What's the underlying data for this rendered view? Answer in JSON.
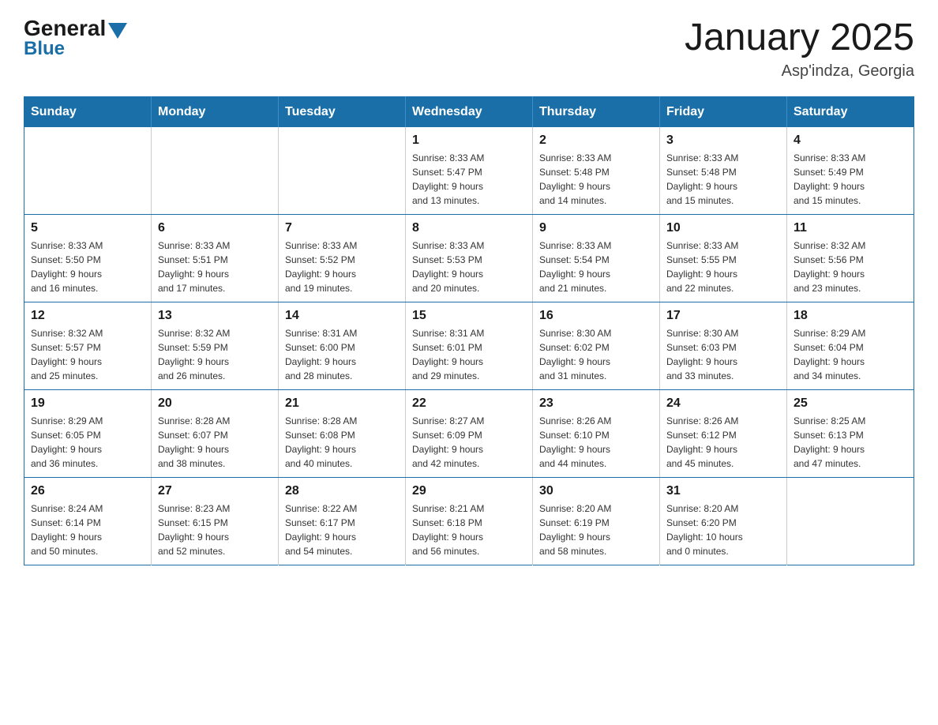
{
  "header": {
    "logo_general": "General",
    "logo_blue": "Blue",
    "title": "January 2025",
    "subtitle": "Asp'indza, Georgia"
  },
  "days_of_week": [
    "Sunday",
    "Monday",
    "Tuesday",
    "Wednesday",
    "Thursday",
    "Friday",
    "Saturday"
  ],
  "weeks": [
    [
      {
        "day": "",
        "info": ""
      },
      {
        "day": "",
        "info": ""
      },
      {
        "day": "",
        "info": ""
      },
      {
        "day": "1",
        "info": "Sunrise: 8:33 AM\nSunset: 5:47 PM\nDaylight: 9 hours\nand 13 minutes."
      },
      {
        "day": "2",
        "info": "Sunrise: 8:33 AM\nSunset: 5:48 PM\nDaylight: 9 hours\nand 14 minutes."
      },
      {
        "day": "3",
        "info": "Sunrise: 8:33 AM\nSunset: 5:48 PM\nDaylight: 9 hours\nand 15 minutes."
      },
      {
        "day": "4",
        "info": "Sunrise: 8:33 AM\nSunset: 5:49 PM\nDaylight: 9 hours\nand 15 minutes."
      }
    ],
    [
      {
        "day": "5",
        "info": "Sunrise: 8:33 AM\nSunset: 5:50 PM\nDaylight: 9 hours\nand 16 minutes."
      },
      {
        "day": "6",
        "info": "Sunrise: 8:33 AM\nSunset: 5:51 PM\nDaylight: 9 hours\nand 17 minutes."
      },
      {
        "day": "7",
        "info": "Sunrise: 8:33 AM\nSunset: 5:52 PM\nDaylight: 9 hours\nand 19 minutes."
      },
      {
        "day": "8",
        "info": "Sunrise: 8:33 AM\nSunset: 5:53 PM\nDaylight: 9 hours\nand 20 minutes."
      },
      {
        "day": "9",
        "info": "Sunrise: 8:33 AM\nSunset: 5:54 PM\nDaylight: 9 hours\nand 21 minutes."
      },
      {
        "day": "10",
        "info": "Sunrise: 8:33 AM\nSunset: 5:55 PM\nDaylight: 9 hours\nand 22 minutes."
      },
      {
        "day": "11",
        "info": "Sunrise: 8:32 AM\nSunset: 5:56 PM\nDaylight: 9 hours\nand 23 minutes."
      }
    ],
    [
      {
        "day": "12",
        "info": "Sunrise: 8:32 AM\nSunset: 5:57 PM\nDaylight: 9 hours\nand 25 minutes."
      },
      {
        "day": "13",
        "info": "Sunrise: 8:32 AM\nSunset: 5:59 PM\nDaylight: 9 hours\nand 26 minutes."
      },
      {
        "day": "14",
        "info": "Sunrise: 8:31 AM\nSunset: 6:00 PM\nDaylight: 9 hours\nand 28 minutes."
      },
      {
        "day": "15",
        "info": "Sunrise: 8:31 AM\nSunset: 6:01 PM\nDaylight: 9 hours\nand 29 minutes."
      },
      {
        "day": "16",
        "info": "Sunrise: 8:30 AM\nSunset: 6:02 PM\nDaylight: 9 hours\nand 31 minutes."
      },
      {
        "day": "17",
        "info": "Sunrise: 8:30 AM\nSunset: 6:03 PM\nDaylight: 9 hours\nand 33 minutes."
      },
      {
        "day": "18",
        "info": "Sunrise: 8:29 AM\nSunset: 6:04 PM\nDaylight: 9 hours\nand 34 minutes."
      }
    ],
    [
      {
        "day": "19",
        "info": "Sunrise: 8:29 AM\nSunset: 6:05 PM\nDaylight: 9 hours\nand 36 minutes."
      },
      {
        "day": "20",
        "info": "Sunrise: 8:28 AM\nSunset: 6:07 PM\nDaylight: 9 hours\nand 38 minutes."
      },
      {
        "day": "21",
        "info": "Sunrise: 8:28 AM\nSunset: 6:08 PM\nDaylight: 9 hours\nand 40 minutes."
      },
      {
        "day": "22",
        "info": "Sunrise: 8:27 AM\nSunset: 6:09 PM\nDaylight: 9 hours\nand 42 minutes."
      },
      {
        "day": "23",
        "info": "Sunrise: 8:26 AM\nSunset: 6:10 PM\nDaylight: 9 hours\nand 44 minutes."
      },
      {
        "day": "24",
        "info": "Sunrise: 8:26 AM\nSunset: 6:12 PM\nDaylight: 9 hours\nand 45 minutes."
      },
      {
        "day": "25",
        "info": "Sunrise: 8:25 AM\nSunset: 6:13 PM\nDaylight: 9 hours\nand 47 minutes."
      }
    ],
    [
      {
        "day": "26",
        "info": "Sunrise: 8:24 AM\nSunset: 6:14 PM\nDaylight: 9 hours\nand 50 minutes."
      },
      {
        "day": "27",
        "info": "Sunrise: 8:23 AM\nSunset: 6:15 PM\nDaylight: 9 hours\nand 52 minutes."
      },
      {
        "day": "28",
        "info": "Sunrise: 8:22 AM\nSunset: 6:17 PM\nDaylight: 9 hours\nand 54 minutes."
      },
      {
        "day": "29",
        "info": "Sunrise: 8:21 AM\nSunset: 6:18 PM\nDaylight: 9 hours\nand 56 minutes."
      },
      {
        "day": "30",
        "info": "Sunrise: 8:20 AM\nSunset: 6:19 PM\nDaylight: 9 hours\nand 58 minutes."
      },
      {
        "day": "31",
        "info": "Sunrise: 8:20 AM\nSunset: 6:20 PM\nDaylight: 10 hours\nand 0 minutes."
      },
      {
        "day": "",
        "info": ""
      }
    ]
  ]
}
